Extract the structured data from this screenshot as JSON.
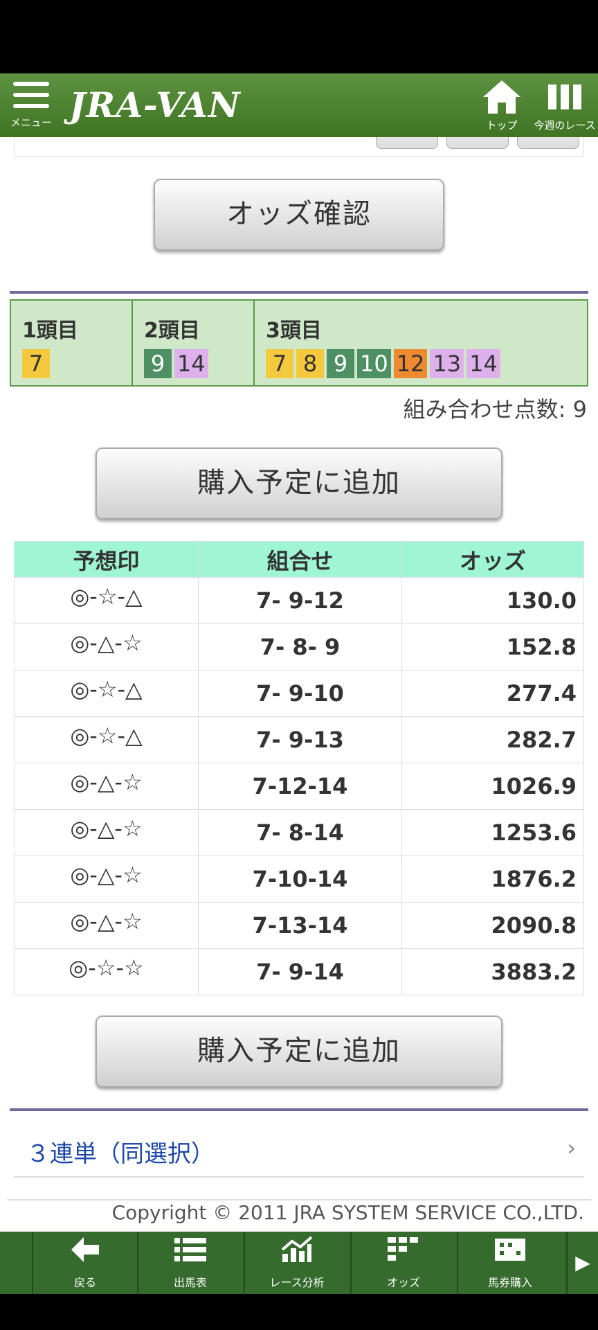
{
  "header": {
    "menu_label": "メニュー",
    "logo_text": "JRA-VAN",
    "home_label": "トップ",
    "weekly_races_label": "今週のレース",
    "bg_color": "#4a7f2c"
  },
  "odds_check_button": "オッズ確認",
  "selection": {
    "cols": [
      {
        "title": "1頭目",
        "horses": [
          {
            "num": "7",
            "color": "yellow"
          }
        ]
      },
      {
        "title": "2頭目",
        "horses": [
          {
            "num": "9",
            "color": "green"
          },
          {
            "num": "14",
            "color": "pink"
          }
        ]
      },
      {
        "title": "3頭目",
        "horses": [
          {
            "num": "7",
            "color": "yellow"
          },
          {
            "num": "8",
            "color": "yellow"
          },
          {
            "num": "9",
            "color": "green"
          },
          {
            "num": "10",
            "color": "green"
          },
          {
            "num": "12",
            "color": "orange"
          },
          {
            "num": "13",
            "color": "pink"
          },
          {
            "num": "14",
            "color": "pink"
          }
        ]
      }
    ],
    "combo_count": "組み合わせ点数: 9"
  },
  "add_button_top": "購入予定に追加",
  "table": {
    "headers": [
      "予想印",
      "組合せ",
      "オッズ"
    ],
    "rows": [
      {
        "mark": "◎-☆-△",
        "combo": "7- 9-12",
        "odds": "130.0"
      },
      {
        "mark": "◎-△-☆",
        "combo": "7- 8- 9",
        "odds": "152.8"
      },
      {
        "mark": "◎-☆-△",
        "combo": "7- 9-10",
        "odds": "277.4"
      },
      {
        "mark": "◎-☆-△",
        "combo": "7- 9-13",
        "odds": "282.7"
      },
      {
        "mark": "◎-△-☆",
        "combo": "7-12-14",
        "odds": "1026.9"
      },
      {
        "mark": "◎-△-☆",
        "combo": "7- 8-14",
        "odds": "1253.6"
      },
      {
        "mark": "◎-△-☆",
        "combo": "7-10-14",
        "odds": "1876.2"
      },
      {
        "mark": "◎-△-☆",
        "combo": "7-13-14",
        "odds": "2090.8"
      },
      {
        "mark": "◎-☆-☆",
        "combo": "7- 9-14",
        "odds": "3883.2"
      }
    ]
  },
  "add_button_bottom": "購入予定に追加",
  "link": {
    "label": "３連単（同選択）",
    "chevron": "›"
  },
  "copyright": "Copyright © 2011 JRA SYSTEM SERVICE CO.,LTD.",
  "footer": {
    "items": [
      {
        "label": "戻る",
        "icon": "back-arrow-icon"
      },
      {
        "label": "出馬表",
        "icon": "list-icon"
      },
      {
        "label": "レース分析",
        "icon": "chart-icon"
      },
      {
        "label": "オッズ",
        "icon": "grid-icon"
      },
      {
        "label": "馬券購入",
        "icon": "ticket-icon"
      }
    ],
    "next_icon": "play-icon",
    "bg_color": "#356b2d"
  }
}
